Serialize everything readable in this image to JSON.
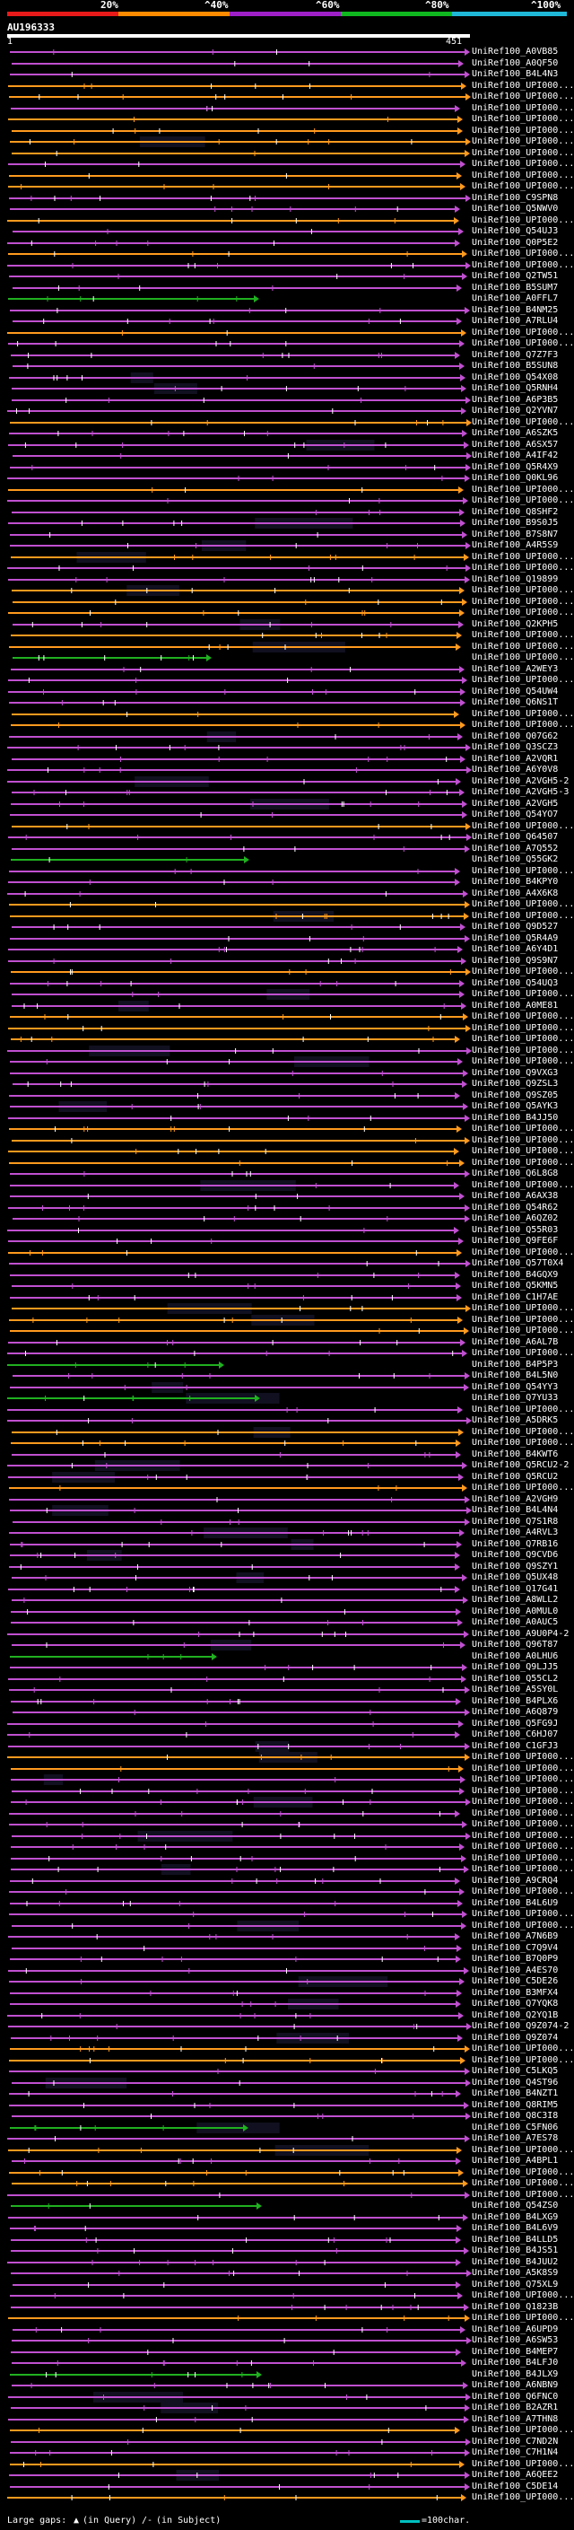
{
  "scale": {
    "ticks": [
      "20%",
      "^40%",
      "^60%",
      "^80%",
      "^100%"
    ],
    "colors": [
      "#e81a1a",
      "#ff8c00",
      "#a020c8",
      "#10b820",
      "#20b8d8"
    ]
  },
  "query": {
    "name": "AU196333",
    "start": "1",
    "end": "451"
  },
  "legend": {
    "gaps_label": "Large gaps:",
    "in_query": "(in Query)",
    "in_subject": "(in Subject)",
    "scale_text": "=100char."
  },
  "hit_colors": {
    "orange": "#ff9a1e",
    "violet": "#c050d0",
    "green": "#20b020",
    "dark": "#1a1a2a",
    "box": "#101020"
  },
  "hits": [
    {
      "label": "UniRef100_A0VB85",
      "c": "violet"
    },
    {
      "label": "UniRef100_A0QF50",
      "c": "violet"
    },
    {
      "label": "UniRef100_B4L4N3",
      "c": "violet"
    },
    {
      "label": "UniRef100_UPI000...",
      "c": "orange"
    },
    {
      "label": "UniRef100_UPI000...",
      "c": "orange"
    },
    {
      "label": "UniRef100_UPI000...",
      "c": "violet"
    },
    {
      "label": "UniRef100_UPI000...",
      "c": "orange"
    },
    {
      "label": "UniRef100_UPI000...",
      "c": "orange"
    },
    {
      "label": "UniRef100_UPI000...",
      "c": "orange"
    },
    {
      "label": "UniRef100_UPI000...",
      "c": "orange"
    },
    {
      "label": "UniRef100_UPI000...",
      "c": "violet"
    },
    {
      "label": "UniRef100_UPI000...",
      "c": "orange"
    },
    {
      "label": "UniRef100_UPI000...",
      "c": "orange"
    },
    {
      "label": "UniRef100_C9SPN8",
      "c": "violet"
    },
    {
      "label": "UniRef100_Q5NWV0",
      "c": "violet"
    },
    {
      "label": "UniRef100_UPI000...",
      "c": "orange"
    },
    {
      "label": "UniRef100_Q54UJ3",
      "c": "violet"
    },
    {
      "label": "UniRef100_Q0P5E2",
      "c": "violet"
    },
    {
      "label": "UniRef100_UPI000...",
      "c": "orange"
    },
    {
      "label": "UniRef100_UPI000...",
      "c": "violet"
    },
    {
      "label": "UniRef100_Q2TW51",
      "c": "violet"
    },
    {
      "label": "UniRef100_B5SUM7",
      "c": "violet"
    },
    {
      "label": "UniRef100_A0FFL7",
      "c": "green"
    },
    {
      "label": "UniRef100_B4NM25",
      "c": "violet"
    },
    {
      "label": "UniRef100_A7RLU4",
      "c": "violet"
    },
    {
      "label": "UniRef100_UPI000...",
      "c": "orange"
    },
    {
      "label": "UniRef100_UPI000...",
      "c": "violet"
    },
    {
      "label": "UniRef100_Q7Z7F3",
      "c": "violet"
    },
    {
      "label": "UniRef100_B5SUN8",
      "c": "violet"
    },
    {
      "label": "UniRef100_Q54X08",
      "c": "violet"
    },
    {
      "label": "UniRef100_Q5RNH4",
      "c": "violet"
    },
    {
      "label": "UniRef100_A6P3B5",
      "c": "violet"
    },
    {
      "label": "UniRef100_Q2YVN7",
      "c": "violet"
    },
    {
      "label": "UniRef100_UPI000...",
      "c": "orange"
    },
    {
      "label": "UniRef100_A6SZK5",
      "c": "violet"
    },
    {
      "label": "UniRef100_A6SX57",
      "c": "violet"
    },
    {
      "label": "UniRef100_A4IF42",
      "c": "violet"
    },
    {
      "label": "UniRef100_Q5R4X9",
      "c": "violet"
    },
    {
      "label": "UniRef100_Q0KL96",
      "c": "violet"
    },
    {
      "label": "UniRef100_UPI000...",
      "c": "orange"
    },
    {
      "label": "UniRef100_UPI000...",
      "c": "violet"
    },
    {
      "label": "UniRef100_Q8SHF2",
      "c": "violet"
    },
    {
      "label": "UniRef100_B9S0J5",
      "c": "violet"
    },
    {
      "label": "UniRef100_B7S8N7",
      "c": "violet"
    },
    {
      "label": "UniRef100_A4R5S9",
      "c": "violet"
    },
    {
      "label": "UniRef100_UPI000...",
      "c": "orange"
    },
    {
      "label": "UniRef100_UPI000...",
      "c": "violet"
    },
    {
      "label": "UniRef100_Q19899",
      "c": "violet"
    },
    {
      "label": "UniRef100_UPI000...",
      "c": "orange"
    },
    {
      "label": "UniRef100_UPI000...",
      "c": "orange"
    },
    {
      "label": "UniRef100_UPI000...",
      "c": "orange"
    },
    {
      "label": "UniRef100_Q2KPH5",
      "c": "violet"
    },
    {
      "label": "UniRef100_UPI000...",
      "c": "orange"
    },
    {
      "label": "UniRef100_UPI000...",
      "c": "orange"
    },
    {
      "label": "UniRef100_UPI000...",
      "c": "green"
    },
    {
      "label": "UniRef100_A2WEY3",
      "c": "violet"
    },
    {
      "label": "UniRef100_UPI000...",
      "c": "violet"
    },
    {
      "label": "UniRef100_Q54UW4",
      "c": "violet"
    },
    {
      "label": "UniRef100_Q6NS1T",
      "c": "violet"
    },
    {
      "label": "UniRef100_UPI000...",
      "c": "orange"
    },
    {
      "label": "UniRef100_UPI000...",
      "c": "orange"
    },
    {
      "label": "UniRef100_Q07G62",
      "c": "violet"
    },
    {
      "label": "UniRef100_Q3SCZ3",
      "c": "violet"
    },
    {
      "label": "UniRef100_A2VQR1",
      "c": "violet"
    },
    {
      "label": "UniRef100_A6Y0V8",
      "c": "violet"
    },
    {
      "label": "UniRef100_A2VGH5-2",
      "c": "violet"
    },
    {
      "label": "UniRef100_A2VGH5-3",
      "c": "violet"
    },
    {
      "label": "UniRef100_A2VGH5",
      "c": "violet"
    },
    {
      "label": "UniRef100_Q54YO7",
      "c": "violet"
    },
    {
      "label": "UniRef100_UPI000...",
      "c": "orange"
    },
    {
      "label": "UniRef100_Q64507",
      "c": "violet"
    },
    {
      "label": "UniRef100_A7Q552",
      "c": "violet"
    },
    {
      "label": "UniRef100_Q55GK2",
      "c": "green"
    },
    {
      "label": "UniRef100_UPI000...",
      "c": "violet"
    },
    {
      "label": "UniRef100_B4KPY0",
      "c": "violet"
    },
    {
      "label": "UniRef100_A4X6K8",
      "c": "violet"
    },
    {
      "label": "UniRef100_UPI000...",
      "c": "orange"
    },
    {
      "label": "UniRef100_UPI000...",
      "c": "orange"
    },
    {
      "label": "UniRef100_Q9D527",
      "c": "violet"
    },
    {
      "label": "UniRef100_Q5R4A9",
      "c": "violet"
    },
    {
      "label": "UniRef100_A6Y4D1",
      "c": "violet"
    },
    {
      "label": "UniRef100_Q9S9N7",
      "c": "violet"
    },
    {
      "label": "UniRef100_UPI000...",
      "c": "orange"
    },
    {
      "label": "UniRef100_Q54UQ3",
      "c": "violet"
    },
    {
      "label": "UniRef100_UPI000...",
      "c": "violet"
    },
    {
      "label": "UniRef100_A0ME81",
      "c": "violet"
    },
    {
      "label": "UniRef100_UPI000...",
      "c": "orange"
    },
    {
      "label": "UniRef100_UPI000...",
      "c": "orange"
    },
    {
      "label": "UniRef100_UPI000...",
      "c": "orange"
    },
    {
      "label": "UniRef100_UPI000...",
      "c": "violet"
    },
    {
      "label": "UniRef100_UPI000...",
      "c": "violet"
    },
    {
      "label": "UniRef100_Q9VXG3",
      "c": "violet"
    },
    {
      "label": "UniRef100_Q9ZSL3",
      "c": "violet"
    },
    {
      "label": "UniRef100_Q9SZ05",
      "c": "violet"
    },
    {
      "label": "UniRef100_Q5AYK3",
      "c": "violet"
    },
    {
      "label": "UniRef100_B4JJ50",
      "c": "violet"
    },
    {
      "label": "UniRef100_UPI000...",
      "c": "orange"
    },
    {
      "label": "UniRef100_UPI000...",
      "c": "orange"
    },
    {
      "label": "UniRef100_UPI000...",
      "c": "orange"
    },
    {
      "label": "UniRef100_UPI000...",
      "c": "orange"
    },
    {
      "label": "UniRef100_Q6L8G8",
      "c": "violet"
    },
    {
      "label": "UniRef100_UPI000...",
      "c": "violet"
    },
    {
      "label": "UniRef100_A6AX38",
      "c": "violet"
    },
    {
      "label": "UniRef100_Q54R62",
      "c": "violet"
    },
    {
      "label": "UniRef100_A6QZ02",
      "c": "violet"
    },
    {
      "label": "UniRef100_Q55R03",
      "c": "violet"
    },
    {
      "label": "UniRef100_Q9FE6F",
      "c": "violet"
    },
    {
      "label": "UniRef100_UPI000...",
      "c": "orange"
    },
    {
      "label": "UniRef100_Q57T0X4",
      "c": "violet"
    },
    {
      "label": "UniRef100_B4GQX9",
      "c": "violet"
    },
    {
      "label": "UniRef100_Q5KMN5",
      "c": "violet"
    },
    {
      "label": "UniRef100_C1H7AE",
      "c": "violet"
    },
    {
      "label": "UniRef100_UPI000...",
      "c": "orange"
    },
    {
      "label": "UniRef100_UPI000...",
      "c": "orange"
    },
    {
      "label": "UniRef100_UPI000...",
      "c": "orange"
    },
    {
      "label": "UniRef100_A6AL7B",
      "c": "violet"
    },
    {
      "label": "UniRef100_UPI000...",
      "c": "violet"
    },
    {
      "label": "UniRef100_B4P5P3",
      "c": "green"
    },
    {
      "label": "UniRef100_B4L5N0",
      "c": "violet"
    },
    {
      "label": "UniRef100_Q54YY3",
      "c": "violet"
    },
    {
      "label": "UniRef100_Q7YU33",
      "c": "green"
    },
    {
      "label": "UniRef100_UPI000...",
      "c": "violet"
    },
    {
      "label": "UniRef100_A5DRK5",
      "c": "violet"
    },
    {
      "label": "UniRef100_UPI000...",
      "c": "orange"
    },
    {
      "label": "UniRef100_UPI000...",
      "c": "orange"
    },
    {
      "label": "UniRef100_B4KWT6",
      "c": "violet"
    },
    {
      "label": "UniRef100_Q5RCU2-2",
      "c": "violet"
    },
    {
      "label": "UniRef100_Q5RCU2",
      "c": "violet"
    },
    {
      "label": "UniRef100_UPI000...",
      "c": "orange"
    },
    {
      "label": "UniRef100_A2VGH9",
      "c": "violet"
    },
    {
      "label": "UniRef100_B4L4N4",
      "c": "violet"
    },
    {
      "label": "UniRef100_Q7S1R8",
      "c": "violet"
    },
    {
      "label": "UniRef100_A4RVL3",
      "c": "violet"
    },
    {
      "label": "UniRef100_Q7RB16",
      "c": "violet"
    },
    {
      "label": "UniRef100_Q9CVD6",
      "c": "violet"
    },
    {
      "label": "UniRef100_Q9SZY1",
      "c": "violet"
    },
    {
      "label": "UniRef100_Q5UX48",
      "c": "violet"
    },
    {
      "label": "UniRef100_Q17G41",
      "c": "violet"
    },
    {
      "label": "UniRef100_A8WLL2",
      "c": "violet"
    },
    {
      "label": "UniRef100_A0MUL0",
      "c": "violet"
    },
    {
      "label": "UniRef100_A0AUC5",
      "c": "violet"
    },
    {
      "label": "UniRef100_A9U0P4-2",
      "c": "violet"
    },
    {
      "label": "UniRef100_Q96T87",
      "c": "violet"
    },
    {
      "label": "UniRef100_A0LHU6",
      "c": "green"
    },
    {
      "label": "UniRef100_Q9LJJ5",
      "c": "violet"
    },
    {
      "label": "UniRef100_Q55CL2",
      "c": "violet"
    },
    {
      "label": "UniRef100_A5SY0L",
      "c": "violet"
    },
    {
      "label": "UniRef100_B4PLX6",
      "c": "violet"
    },
    {
      "label": "UniRef100_A6Q879",
      "c": "violet"
    },
    {
      "label": "UniRef100_Q5FG9J",
      "c": "violet"
    },
    {
      "label": "UniRef100_C6HJ07",
      "c": "violet"
    },
    {
      "label": "UniRef100_C1GFJ3",
      "c": "violet"
    },
    {
      "label": "UniRef100_UPI000...",
      "c": "orange"
    },
    {
      "label": "UniRef100_UPI000...",
      "c": "orange"
    },
    {
      "label": "UniRef100_UPI000...",
      "c": "violet"
    },
    {
      "label": "UniRef100_UPI000...",
      "c": "violet"
    },
    {
      "label": "UniRef100_UPI000...",
      "c": "violet"
    },
    {
      "label": "UniRef100_UPI000...",
      "c": "violet"
    },
    {
      "label": "UniRef100_UPI000...",
      "c": "violet"
    },
    {
      "label": "UniRef100_UPI000...",
      "c": "violet"
    },
    {
      "label": "UniRef100_UPI000...",
      "c": "violet"
    },
    {
      "label": "UniRef100_UPI000...",
      "c": "violet"
    },
    {
      "label": "UniRef100_UPI000...",
      "c": "violet"
    },
    {
      "label": "UniRef100_A9CRQ4",
      "c": "violet"
    },
    {
      "label": "UniRef100_UPI000...",
      "c": "violet"
    },
    {
      "label": "UniRef100_B4L6U9",
      "c": "violet"
    },
    {
      "label": "UniRef100_UPI000...",
      "c": "violet"
    },
    {
      "label": "UniRef100_UPI000...",
      "c": "violet"
    },
    {
      "label": "UniRef100_A7N6B9",
      "c": "violet"
    },
    {
      "label": "UniRef100_C7Q9V4",
      "c": "violet"
    },
    {
      "label": "UniRef100_B7Q0P9",
      "c": "violet"
    },
    {
      "label": "UniRef100_A4ES70",
      "c": "violet"
    },
    {
      "label": "UniRef100_C5DE26",
      "c": "violet"
    },
    {
      "label": "UniRef100_B3MFX4",
      "c": "violet"
    },
    {
      "label": "UniRef100_Q7YQK8",
      "c": "violet"
    },
    {
      "label": "UniRef100_Q2YQ1B",
      "c": "violet"
    },
    {
      "label": "UniRef100_Q9Z074-2",
      "c": "violet"
    },
    {
      "label": "UniRef100_Q9Z074",
      "c": "violet"
    },
    {
      "label": "UniRef100_UPI000...",
      "c": "orange"
    },
    {
      "label": "UniRef100_UPI000...",
      "c": "orange"
    },
    {
      "label": "UniRef100_C5LKQ5",
      "c": "violet"
    },
    {
      "label": "UniRef100_Q4ST96",
      "c": "violet"
    },
    {
      "label": "UniRef100_B4NZT1",
      "c": "violet"
    },
    {
      "label": "UniRef100_Q8RIM5",
      "c": "violet"
    },
    {
      "label": "UniRef100_Q8C3I8",
      "c": "violet"
    },
    {
      "label": "UniRef100_C5FN06",
      "c": "green"
    },
    {
      "label": "UniRef100_A7ES78",
      "c": "violet"
    },
    {
      "label": "UniRef100_UPI000...",
      "c": "orange"
    },
    {
      "label": "UniRef100_A4BPL1",
      "c": "violet"
    },
    {
      "label": "UniRef100_UPI000...",
      "c": "orange"
    },
    {
      "label": "UniRef100_UPI000...",
      "c": "orange"
    },
    {
      "label": "UniRef100_UPI000...",
      "c": "violet"
    },
    {
      "label": "UniRef100_Q54ZS0",
      "c": "green"
    },
    {
      "label": "UniRef100_B4LXG9",
      "c": "violet"
    },
    {
      "label": "UniRef100_B4L6V9",
      "c": "violet"
    },
    {
      "label": "UniRef100_B4LLD5",
      "c": "violet"
    },
    {
      "label": "UniRef100_B4JS51",
      "c": "violet"
    },
    {
      "label": "UniRef100_B4JUU2",
      "c": "violet"
    },
    {
      "label": "UniRef100_A5K8S9",
      "c": "violet"
    },
    {
      "label": "UniRef100_Q75XL9",
      "c": "violet"
    },
    {
      "label": "UniRef100_UPI000...",
      "c": "violet"
    },
    {
      "label": "UniRef100_Q1823B",
      "c": "violet"
    },
    {
      "label": "UniRef100_UPI000...",
      "c": "orange"
    },
    {
      "label": "UniRef100_A6UPD9",
      "c": "violet"
    },
    {
      "label": "UniRef100_A6SW53",
      "c": "violet"
    },
    {
      "label": "UniRef100_B4MEP7",
      "c": "violet"
    },
    {
      "label": "UniRef100_B4LFJ0",
      "c": "violet"
    },
    {
      "label": "UniRef100_B4JLX9",
      "c": "green"
    },
    {
      "label": "UniRef100_A6NBN9",
      "c": "violet"
    },
    {
      "label": "UniRef100_Q6FNC0",
      "c": "violet"
    },
    {
      "label": "UniRef100_B2AZR1",
      "c": "violet"
    },
    {
      "label": "UniRef100_A7THN8",
      "c": "violet"
    },
    {
      "label": "UniRef100_UPI000...",
      "c": "orange"
    },
    {
      "label": "UniRef100_C7ND2N",
      "c": "violet"
    },
    {
      "label": "UniRef100_C7H1N4",
      "c": "violet"
    },
    {
      "label": "UniRef100_UPI000...",
      "c": "orange"
    },
    {
      "label": "UniRef100_A6QEE2",
      "c": "violet"
    },
    {
      "label": "UniRef100_C5DE14",
      "c": "violet"
    },
    {
      "label": "UniRef100_UPI000...",
      "c": "orange"
    }
  ]
}
